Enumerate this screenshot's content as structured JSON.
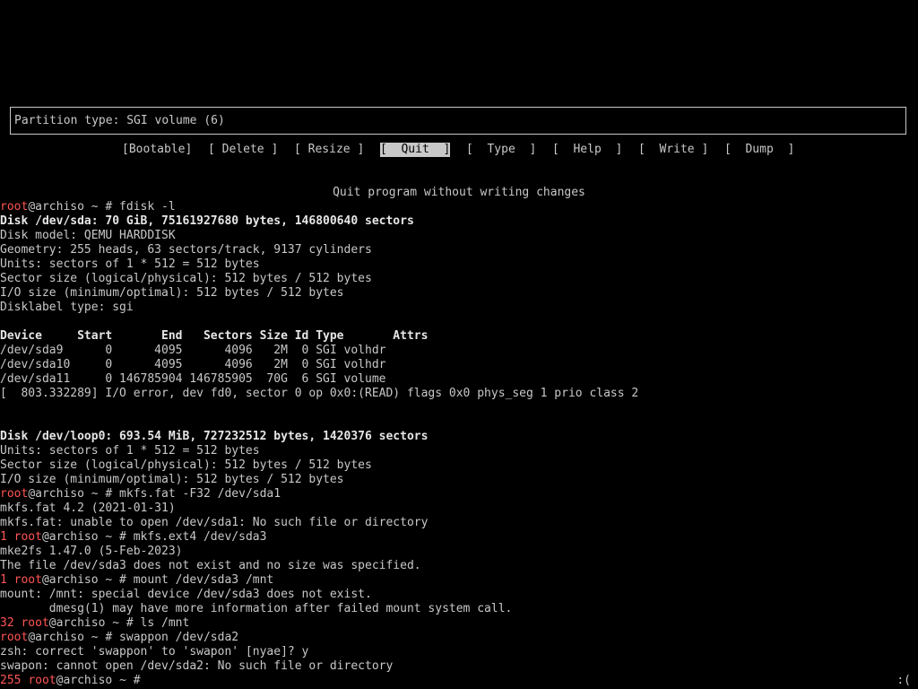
{
  "cfdisk": {
    "partition_type_line": "Partition type: SGI volume (6)",
    "menu": [
      {
        "label": "[Bootable]",
        "selected": false
      },
      {
        "label": "[ Delete ]",
        "selected": false
      },
      {
        "label": "[ Resize ]",
        "selected": false
      },
      {
        "label": "[  Quit  ]",
        "selected": true
      },
      {
        "label": "[  Type  ]",
        "selected": false
      },
      {
        "label": "[  Help  ]",
        "selected": false
      },
      {
        "label": "[  Write ]",
        "selected": false
      },
      {
        "label": "[  Dump  ]",
        "selected": false
      }
    ],
    "hint": "Quit program without writing changes"
  },
  "terminal": {
    "lines": [
      {
        "status": "",
        "prompt": "root",
        "rest": "@archiso ~ # fdisk -l",
        "bold": false
      },
      {
        "status": "",
        "prompt": "",
        "rest": "Disk /dev/sda: 70 GiB, 75161927680 bytes, 146800640 sectors",
        "bold": true
      },
      {
        "status": "",
        "prompt": "",
        "rest": "Disk model: QEMU HARDDISK",
        "bold": false
      },
      {
        "status": "",
        "prompt": "",
        "rest": "Geometry: 255 heads, 63 sectors/track, 9137 cylinders",
        "bold": false
      },
      {
        "status": "",
        "prompt": "",
        "rest": "Units: sectors of 1 * 512 = 512 bytes",
        "bold": false
      },
      {
        "status": "",
        "prompt": "",
        "rest": "Sector size (logical/physical): 512 bytes / 512 bytes",
        "bold": false
      },
      {
        "status": "",
        "prompt": "",
        "rest": "I/O size (minimum/optimal): 512 bytes / 512 bytes",
        "bold": false
      },
      {
        "status": "",
        "prompt": "",
        "rest": "Disklabel type: sgi",
        "bold": false
      },
      {
        "status": "",
        "prompt": "",
        "rest": "",
        "bold": false
      },
      {
        "status": "",
        "prompt": "",
        "rest": "Device     Start       End   Sectors Size Id Type       Attrs",
        "bold": true
      },
      {
        "status": "",
        "prompt": "",
        "rest": "/dev/sda9      0      4095      4096   2M  0 SGI volhdr",
        "bold": false
      },
      {
        "status": "",
        "prompt": "",
        "rest": "/dev/sda10     0      4095      4096   2M  0 SGI volhdr",
        "bold": false
      },
      {
        "status": "",
        "prompt": "",
        "rest": "/dev/sda11     0 146785904 146785905  70G  6 SGI volume",
        "bold": false
      },
      {
        "status": "",
        "prompt": "",
        "rest": "[  803.332289] I/O error, dev fd0, sector 0 op 0x0:(READ) flags 0x0 phys_seg 1 prio class 2",
        "bold": false
      },
      {
        "status": "",
        "prompt": "",
        "rest": "",
        "bold": false
      },
      {
        "status": "",
        "prompt": "",
        "rest": "",
        "bold": false
      },
      {
        "status": "",
        "prompt": "",
        "rest": "Disk /dev/loop0: 693.54 MiB, 727232512 bytes, 1420376 sectors",
        "bold": true
      },
      {
        "status": "",
        "prompt": "",
        "rest": "Units: sectors of 1 * 512 = 512 bytes",
        "bold": false
      },
      {
        "status": "",
        "prompt": "",
        "rest": "Sector size (logical/physical): 512 bytes / 512 bytes",
        "bold": false
      },
      {
        "status": "",
        "prompt": "",
        "rest": "I/O size (minimum/optimal): 512 bytes / 512 bytes",
        "bold": false
      },
      {
        "status": "",
        "prompt": "root",
        "rest": "@archiso ~ # mkfs.fat -F32 /dev/sda1",
        "bold": false
      },
      {
        "status": "",
        "prompt": "",
        "rest": "mkfs.fat 4.2 (2021-01-31)",
        "bold": false
      },
      {
        "status": "",
        "prompt": "",
        "rest": "mkfs.fat: unable to open /dev/sda1: No such file or directory",
        "bold": false
      },
      {
        "status": "1 ",
        "prompt": "root",
        "rest": "@archiso ~ # mkfs.ext4 /dev/sda3",
        "bold": false
      },
      {
        "status": "",
        "prompt": "",
        "rest": "mke2fs 1.47.0 (5-Feb-2023)",
        "bold": false
      },
      {
        "status": "",
        "prompt": "",
        "rest": "The file /dev/sda3 does not exist and no size was specified.",
        "bold": false
      },
      {
        "status": "1 ",
        "prompt": "root",
        "rest": "@archiso ~ # mount /dev/sda3 /mnt",
        "bold": false
      },
      {
        "status": "",
        "prompt": "",
        "rest": "mount: /mnt: special device /dev/sda3 does not exist.",
        "bold": false
      },
      {
        "status": "",
        "prompt": "",
        "rest": "       dmesg(1) may have more information after failed mount system call.",
        "bold": false
      },
      {
        "status": "32 ",
        "prompt": "root",
        "rest": "@archiso ~ # ls /mnt",
        "bold": false
      },
      {
        "status": "",
        "prompt": "root",
        "rest": "@archiso ~ # swappon /dev/sda2",
        "bold": false
      },
      {
        "status": "",
        "prompt": "",
        "rest": "zsh: correct 'swappon' to 'swapon' [nyae]? y",
        "bold": false
      },
      {
        "status": "",
        "prompt": "",
        "rest": "swapon: cannot open /dev/sda2: No such file or directory",
        "bold": false
      },
      {
        "status": "255 ",
        "prompt": "root",
        "rest": "@archiso ~ # ",
        "bold": false
      }
    ],
    "corner_status": ":("
  }
}
